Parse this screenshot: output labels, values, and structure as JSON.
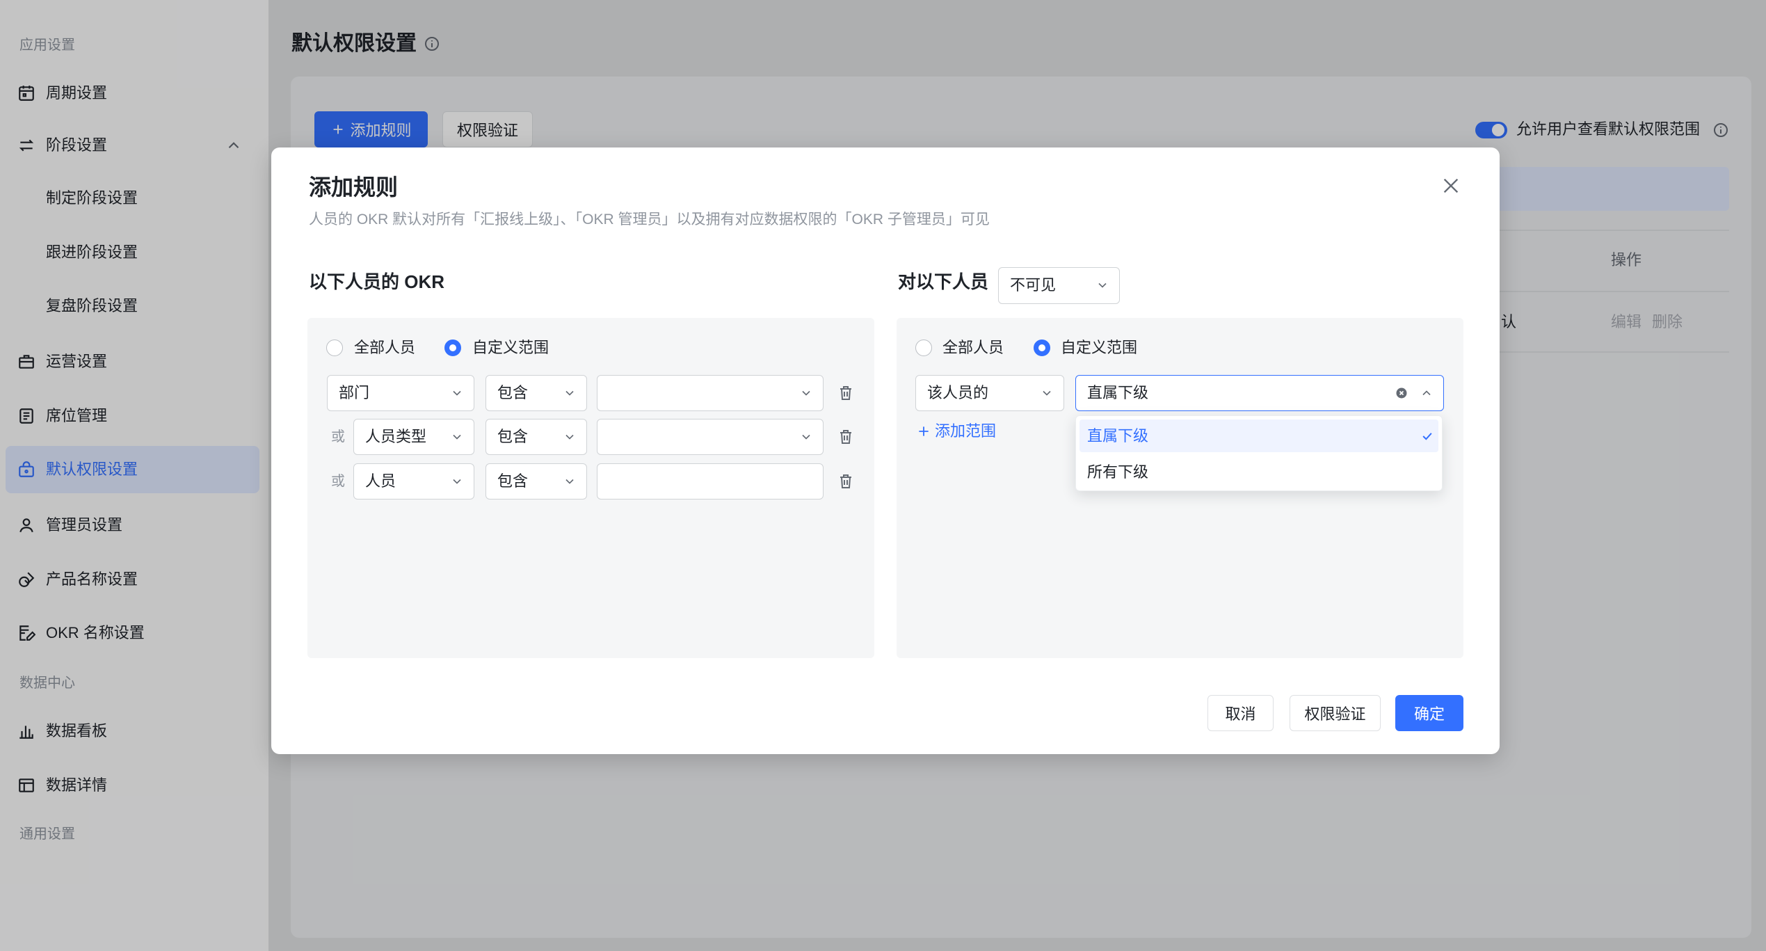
{
  "sidebar": {
    "section_app": "应用设置",
    "items": [
      {
        "label": "周期设置",
        "icon": "calendar-icon"
      },
      {
        "label": "阶段设置",
        "icon": "stages-icon",
        "expanded": true
      },
      {
        "label": "制定阶段设置"
      },
      {
        "label": "跟进阶段设置"
      },
      {
        "label": "复盘阶段设置"
      },
      {
        "label": "运营设置",
        "icon": "briefcase-icon"
      },
      {
        "label": "席位管理",
        "icon": "seat-list-icon"
      },
      {
        "label": "默认权限设置",
        "icon": "permission-icon",
        "active": true
      },
      {
        "label": "管理员设置",
        "icon": "user-icon"
      },
      {
        "label": "产品名称设置",
        "icon": "product-icon"
      },
      {
        "label": "OKR 名称设置",
        "icon": "edit-doc-icon"
      }
    ],
    "section_data": "数据中心",
    "data_items": [
      {
        "label": "数据看板",
        "icon": "bar-chart-icon"
      },
      {
        "label": "数据详情",
        "icon": "table-icon"
      }
    ],
    "section_general": "通用设置"
  },
  "page": {
    "title": "默认权限设置"
  },
  "toolbar": {
    "add_rule": "添加规则",
    "verify": "权限验证",
    "toggle_label": "允许用户查看默认权限范围",
    "toggle_on": true
  },
  "table": {
    "header_action": "操作",
    "rows": [
      {
        "name_fragment": "认",
        "actions": [
          "编辑",
          "删除"
        ]
      }
    ]
  },
  "modal": {
    "title": "添加规则",
    "subtitle": "人员的 OKR 默认对所有「汇报线上级」、「OKR 管理员」以及拥有对应数据权限的「OKR 子管理员」可见",
    "left": {
      "heading": "以下人员的 OKR",
      "radio_all": "全部人员",
      "radio_custom": "自定义范围",
      "selected": "custom",
      "conditions": [
        {
          "connector": "",
          "field": "部门",
          "operator": "包含",
          "value": ""
        },
        {
          "connector": "或",
          "field": "人员类型",
          "operator": "包含",
          "value": ""
        },
        {
          "connector": "或",
          "field": "人员",
          "operator": "包含",
          "value": ""
        }
      ]
    },
    "right": {
      "heading": "对以下人员",
      "visibility": "不可见",
      "radio_all": "全部人员",
      "radio_custom": "自定义范围",
      "selected": "custom",
      "scope_field": "该人员的",
      "scope_value": "直属下级",
      "add_scope": "添加范围",
      "dropdown_options": [
        {
          "label": "直属下级",
          "selected": true
        },
        {
          "label": "所有下级",
          "selected": false
        }
      ]
    },
    "footer": {
      "cancel": "取消",
      "verify": "权限验证",
      "confirm": "确定"
    }
  },
  "colors": {
    "accent": "#3370ff",
    "active_item_bg": "#e1eaff",
    "text": "#1f2329",
    "muted_text": "#8f959e"
  }
}
